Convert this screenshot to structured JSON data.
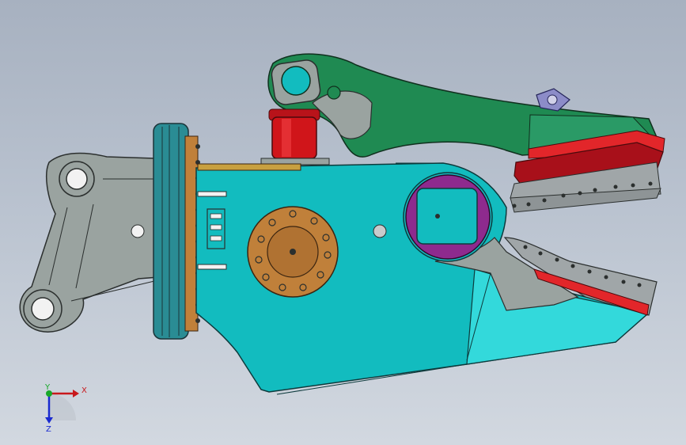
{
  "viewport": {
    "background_top": "#a7b1c0",
    "background_bottom": "#d2d8e0"
  },
  "model": {
    "parts": [
      {
        "name": "mounting-bracket",
        "color": "#9aa3a0"
      },
      {
        "name": "rotation-ring",
        "color": "#2a8c94"
      },
      {
        "name": "bolt-ring",
        "color": "#c0803a"
      },
      {
        "name": "main-body",
        "color": "#12bcbf"
      },
      {
        "name": "lower-jaw-tip",
        "color": "#33d9db"
      },
      {
        "name": "upper-jaw-arm",
        "color": "#1f8a52"
      },
      {
        "name": "hydraulic-cylinder",
        "color": "#d0151a"
      },
      {
        "name": "pivot-bearing",
        "color": "#8e2a8e"
      },
      {
        "name": "cutting-blade-upper",
        "color": "#c1121c"
      },
      {
        "name": "cutting-blade-lower",
        "color": "#e2262a"
      },
      {
        "name": "lift-eye",
        "color": "#8c8cc8"
      }
    ]
  },
  "triad": {
    "x_label": "X",
    "y_label": "Y",
    "z_label": "Z",
    "x_color": "#c8181c",
    "y_color": "#18a82a",
    "z_color": "#1a2ad0"
  }
}
